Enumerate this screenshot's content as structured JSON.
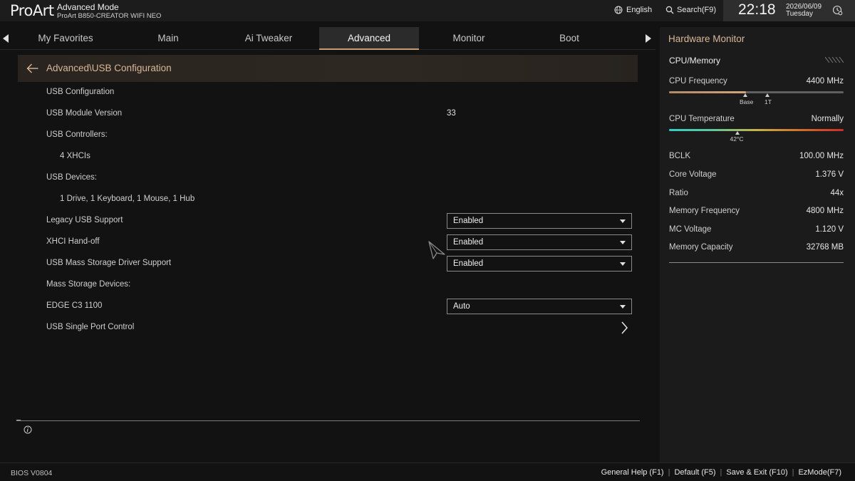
{
  "header": {
    "logo": "ProArt",
    "mode": "Advanced Mode",
    "model": "ProArt B850-CREATOR WIFI NEO",
    "language": "English",
    "search": "Search(F9)",
    "time": "22:18",
    "date": "2026/06/09",
    "weekday": "Tuesday"
  },
  "tabs": [
    {
      "label": "My Favorites"
    },
    {
      "label": "Main"
    },
    {
      "label": "Ai Tweaker"
    },
    {
      "label": "Advanced"
    },
    {
      "label": "Monitor"
    },
    {
      "label": "Boot"
    }
  ],
  "active_tab": "Advanced",
  "breadcrumb": "Advanced\\USB Configuration",
  "settings": [
    {
      "label": "USB Configuration"
    },
    {
      "label": "USB Module Version",
      "value": "33"
    },
    {
      "label": "USB Controllers:"
    },
    {
      "label": "4 XHCIs"
    },
    {
      "label": "USB Devices:"
    },
    {
      "label": "1 Drive, 1 Keyboard, 1 Mouse, 1 Hub"
    },
    {
      "label": "Legacy USB Support",
      "value": "Enabled"
    },
    {
      "label": "XHCI Hand-off",
      "value": "Enabled"
    },
    {
      "label": "USB Mass Storage Driver Support",
      "value": "Enabled"
    },
    {
      "label": "Mass Storage Devices:"
    },
    {
      "label": "EDGE C3 1100",
      "value": "Auto"
    },
    {
      "label": "USB Single Port Control"
    }
  ],
  "hw_monitor": {
    "title": "Hardware Monitor",
    "section": "CPU/Memory",
    "cpu_freq_label": "CPU Frequency",
    "cpu_freq_value": "4400 MHz",
    "cpu_freq_fraction": 0.44,
    "marker_base": "Base",
    "marker_1t": "1T",
    "cpu_temp_label": "CPU Temperature",
    "cpu_temp_value": "Normally",
    "cpu_temp_marker": "42°C",
    "cpu_temp_fraction": 0.39,
    "items": [
      {
        "label": "BCLK",
        "value": "100.00 MHz"
      },
      {
        "label": "Core Voltage",
        "value": "1.376 V"
      },
      {
        "label": "Ratio",
        "value": "44x"
      },
      {
        "label": "Memory Frequency",
        "value": "4800 MHz"
      },
      {
        "label": "MC Voltage",
        "value": "1.120 V"
      },
      {
        "label": "Memory Capacity",
        "value": "32768 MB"
      }
    ]
  },
  "footer": {
    "bios_version": "BIOS V0804",
    "general_help": "General Help (F1)",
    "default": "Default (F5)",
    "save_exit": "Save & Exit (F10)",
    "ez_mode": "EzMode(F7)"
  },
  "colors": {
    "accent": "#d8b896",
    "background": "#121212",
    "panel": "#1b1b1b"
  }
}
